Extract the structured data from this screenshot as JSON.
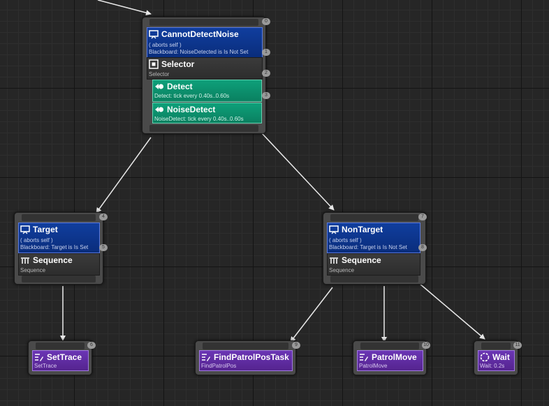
{
  "graph": {
    "root": {
      "index": "0",
      "decorator": {
        "title": "CannotDetectNoise",
        "abort": "( aborts self )",
        "condition": "Blackboard: NoiseDetected is Is Not Set",
        "index": "1"
      },
      "composite": {
        "title": "Selector",
        "subtitle": "Selector",
        "index": "2"
      },
      "services": [
        {
          "title": "Detect",
          "subtitle": "Detect: tick every 0.40s..0.60s",
          "index": "3"
        },
        {
          "title": "NoiseDetect",
          "subtitle": "NoiseDetect: tick every 0.40s..0.60s"
        }
      ]
    },
    "target": {
      "index": "4",
      "decorator": {
        "title": "Target",
        "abort": "( aborts self )",
        "condition": "Blackboard: Target is Is Set",
        "index": "5"
      },
      "composite": {
        "title": "Sequence",
        "subtitle": "Sequence"
      }
    },
    "nontarget": {
      "index": "7",
      "decorator": {
        "title": "NonTarget",
        "abort": "( aborts self )",
        "condition": "Blackboard: Target is Is Not Set",
        "index": "8"
      },
      "composite": {
        "title": "Sequence",
        "subtitle": "Sequence"
      }
    },
    "tasks": {
      "settrace": {
        "title": "SetTrace",
        "subtitle": "SetTrace",
        "index": "6"
      },
      "findpatrol": {
        "title": "FindPatrolPosTask",
        "subtitle": "FindPatrolPos",
        "index": "9"
      },
      "patrolmove": {
        "title": "PatrolMove",
        "subtitle": "PatrolMove",
        "index": "10"
      },
      "wait": {
        "title": "Wait",
        "subtitle": "Wait: 0.2s",
        "index": "11"
      }
    }
  },
  "colors": {
    "wire": "#e8e8e8",
    "decorator": "#0a2d7c",
    "service": "#0a8060",
    "task": "#55248f",
    "composite": "#2d2d2d"
  },
  "icons": {
    "decorator": "monitor-icon",
    "selector": "selector-icon",
    "sequence": "sequence-icon",
    "service": "service-icon",
    "task": "task-icon",
    "wait": "wait-icon"
  }
}
